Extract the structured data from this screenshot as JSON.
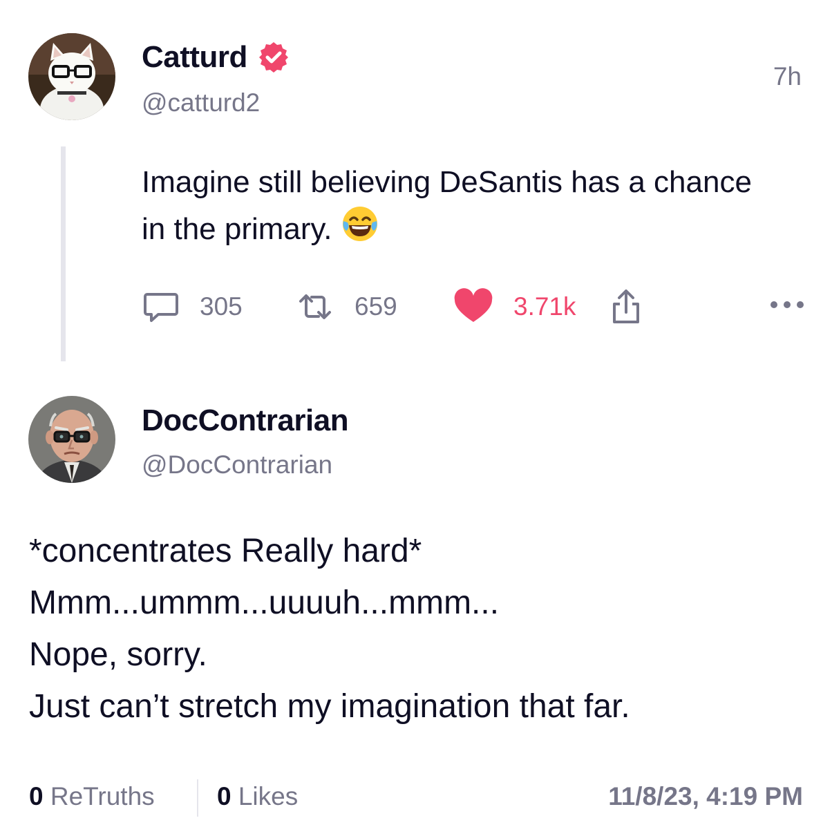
{
  "post": {
    "author": {
      "display_name": "Catturd",
      "handle": "@catturd2",
      "verified": true,
      "avatar": "white-cat-with-glasses"
    },
    "time_ago": "7h",
    "text": "Imagine still believing DeSantis has a chance in the primary.",
    "emoji": "face-with-tears-of-joy",
    "actions": {
      "replies": "305",
      "retruths": "659",
      "likes": "3.71k",
      "liked": true
    }
  },
  "reply": {
    "author": {
      "display_name": "DocContrarian",
      "handle": "@DocContrarian",
      "avatar": "old-man-with-glasses"
    },
    "lines": [
      "*concentrates Really hard*",
      "Mmm...ummm...uuuuh...mmm...",
      "Nope, sorry.",
      "Just can’t stretch my imagination that far."
    ],
    "retruths_count": "0",
    "retruths_label": "ReTruths",
    "likes_count": "0",
    "likes_label": "Likes",
    "timestamp": "11/8/23, 4:19 PM"
  },
  "colors": {
    "text": "#0f0f24",
    "muted": "#767689",
    "like_active": "#f0466c",
    "verified": "#f0466c",
    "thread_line": "#e5e5ec"
  }
}
